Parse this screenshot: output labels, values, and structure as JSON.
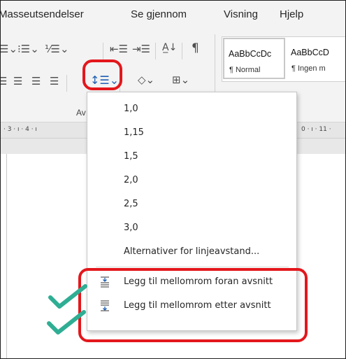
{
  "tabs": [
    "Masseutsendelser",
    "Se gjennom",
    "Visning",
    "Hjelp"
  ],
  "ribbon": {
    "group_label_partial": "Av",
    "styles": [
      {
        "sample": "AaBbCcDc",
        "name": "¶ Normal"
      },
      {
        "sample": "AaBbCcD",
        "name": "¶ Ingen m"
      }
    ]
  },
  "ruler": {
    "left_marks": "· 3 · ı · 4 · ı",
    "right_marks": "0 · ı · 11 ·"
  },
  "menu": {
    "spacing_options": [
      "1,0",
      "1,15",
      "1,5",
      "2,0",
      "2,5",
      "3,0"
    ],
    "options_link": "Alternativer for linjeavstand...",
    "add_before": "Legg til mellomrom foran avsnitt",
    "add_after": "Legg til mellomrom etter avsnitt"
  },
  "colors": {
    "highlight": "#e3171c",
    "check": "#2fae94"
  }
}
